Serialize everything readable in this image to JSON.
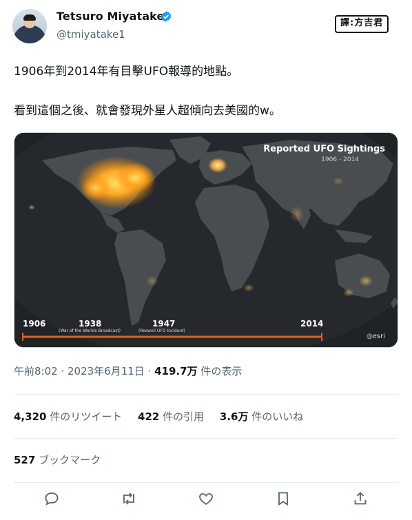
{
  "author": {
    "display_name": "Tetsuro Miyatake",
    "handle": "@tmiyatake1",
    "verified": true
  },
  "translator_badge": "譯:方吉君",
  "tweet": {
    "line1": "1906年到2014年有目擊UFO報導的地點。",
    "line2": "看到這個之後、就會發現外星人超傾向去美國的w。"
  },
  "media": {
    "title": "Reported UFO Sightings",
    "years": "1906 - 2014",
    "timeline": {
      "start": "1906",
      "m1": "1938",
      "m1_sub": "(War of the Worlds Broadcast)",
      "m2": "1947",
      "m2_sub": "(Roswell UFO Incident)",
      "end": "2014"
    },
    "watermark": "esri"
  },
  "meta": {
    "time": "午前8:02 · 2023年6月11日 · ",
    "views": "419.7万",
    "views_suffix": " 件の表示"
  },
  "stats": {
    "retweets": "4,320",
    "retweets_label": " 件のリツイート",
    "quotes": "422",
    "quotes_label": " 件の引用",
    "likes": "3.6万",
    "likes_label": " 件のいいね"
  },
  "bookmarks": {
    "count": "527",
    "label": " ブックマーク"
  },
  "colors": {
    "verified": "#1d9bf0",
    "heat": "#ffb020",
    "timeline": "#e0612a"
  },
  "actions": [
    "reply-icon",
    "retweet-icon",
    "like-icon",
    "bookmark-icon",
    "share-icon"
  ]
}
